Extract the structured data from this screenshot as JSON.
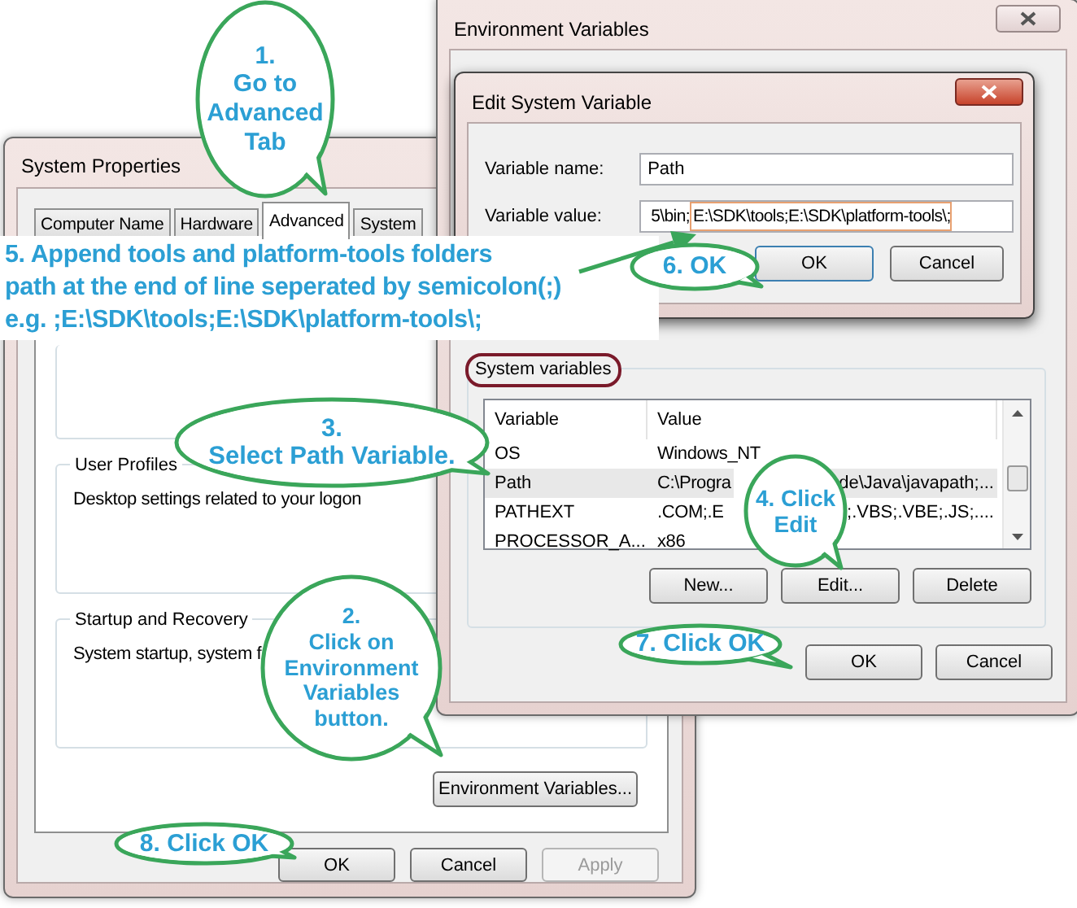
{
  "system_properties": {
    "title": "System Properties",
    "tabs": [
      {
        "label": "Computer Name",
        "selected": false
      },
      {
        "label": "Hardware",
        "selected": false
      },
      {
        "label": "Advanced",
        "selected": true
      },
      {
        "label": "System",
        "selected": false
      }
    ],
    "groups": [
      {
        "title": "User Profiles",
        "text": "Desktop settings related to your logon"
      },
      {
        "title": "Startup and Recovery",
        "text": "System startup, system f"
      }
    ],
    "env_button": "Environment Variables...",
    "buttons": [
      {
        "label": "OK",
        "disabled": false
      },
      {
        "label": "Cancel",
        "disabled": false
      },
      {
        "label": "Apply",
        "disabled": true
      }
    ]
  },
  "environment_variables": {
    "title": "Environment Variables",
    "system_variables": {
      "title": "System variables",
      "columns": [
        "Variable",
        "Value"
      ],
      "rows": [
        {
          "variable": "OS",
          "value_parts": [
            "Windows_NT"
          ],
          "selected": false
        },
        {
          "variable": "Path",
          "value_parts": [
            "C:\\Progra",
            "de\\Java\\javapath;..."
          ],
          "selected": true
        },
        {
          "variable": "PATHEXT",
          "value_parts": [
            ".COM;.E",
            ";.VBS;.VBE;.JS;...."
          ],
          "selected": false
        },
        {
          "variable": "PROCESSOR_A...",
          "value_parts": [
            "x86"
          ],
          "selected": false
        }
      ]
    },
    "table_buttons": [
      "New...",
      "Edit...",
      "Delete"
    ],
    "buttons": [
      "OK",
      "Cancel"
    ]
  },
  "edit_dialog": {
    "title": "Edit System Variable",
    "fields": [
      {
        "label": "Variable name:",
        "value": "Path"
      },
      {
        "label": "Variable value:",
        "value": "5\\bin;",
        "appended": "E:\\SDK\\tools;E:\\SDK\\platform-tools\\;"
      }
    ],
    "buttons": [
      "OK",
      "Cancel"
    ]
  },
  "annotations": {
    "banner": "5. Append tools and platform-tools folders\npath at the end of line seperated by semicolon(;)\ne.g. ;E:\\SDK\\tools;E:\\SDK\\platform-tools\\;",
    "callouts": [
      {
        "text": "1.\nGo to\nAdvanced\nTab"
      },
      {
        "text": "3.\nSelect Path Variable."
      },
      {
        "text": "2.\nClick on\nEnvironment\nVariables\nbutton."
      },
      {
        "text": "4. Click\nEdit"
      },
      {
        "text": "6. OK"
      },
      {
        "text": "7. Click OK"
      },
      {
        "text": "8. Click OK"
      }
    ]
  }
}
